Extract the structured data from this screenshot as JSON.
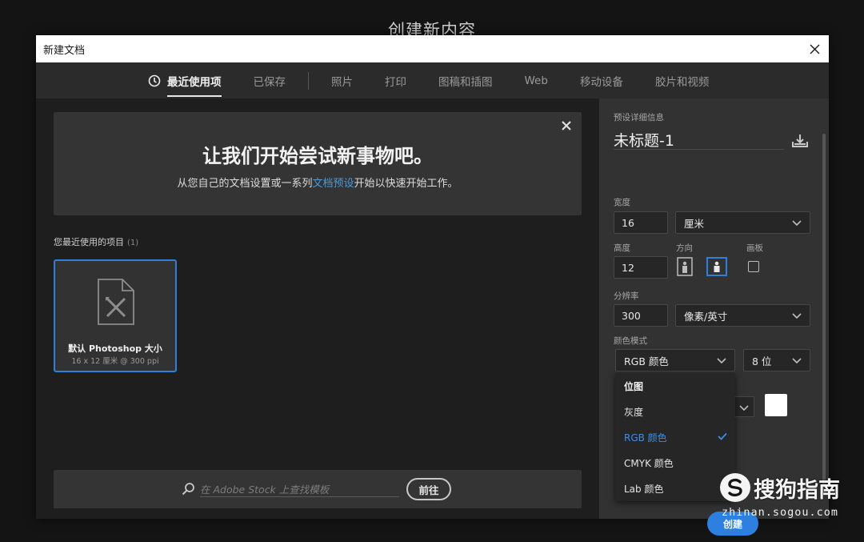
{
  "background_title": "创建新内容",
  "dialog": {
    "title": "新建文档"
  },
  "tabs": [
    {
      "label": "最近使用项",
      "active": true
    },
    {
      "label": "已保存",
      "active": false
    },
    {
      "label": "照片",
      "active": false
    },
    {
      "label": "打印",
      "active": false
    },
    {
      "label": "图稿和插图",
      "active": false
    },
    {
      "label": "Web",
      "active": false
    },
    {
      "label": "移动设备",
      "active": false
    },
    {
      "label": "胶片和视频",
      "active": false
    }
  ],
  "hero": {
    "heading": "让我们开始尝试新事物吧。",
    "text_before": "从您自己的文档设置或一系列",
    "link": "文档预设",
    "text_after": "开始以快速开始工作。"
  },
  "recent": {
    "label": "您最近使用的项目",
    "count": "(1)",
    "items": [
      {
        "name": "默认 Photoshop 大小",
        "info": "16 x 12 厘米 @ 300 ppi"
      }
    ]
  },
  "search": {
    "placeholder": "在 Adobe Stock 上查找模板",
    "go_label": "前往"
  },
  "panel": {
    "section_label": "预设详细信息",
    "doc_name": "未标题-1",
    "width_label": "宽度",
    "width_value": "16",
    "width_unit": "厘米",
    "height_label": "高度",
    "height_value": "12",
    "orientation_label": "方向",
    "artboard_label": "画板",
    "resolution_label": "分辨率",
    "resolution_value": "300",
    "resolution_unit": "像素/英寸",
    "color_mode_label": "颜色模式",
    "color_mode_value": "RGB 颜色",
    "bit_depth": "8 位",
    "color_mode_options": [
      "位图",
      "灰度",
      "RGB 颜色",
      "CMYK 颜色",
      "Lab 颜色"
    ],
    "color_mode_selected": "RGB 颜色",
    "create_label": "创建"
  },
  "watermark": {
    "brand": "搜狗指南",
    "url": "zhinan.sogou.com"
  },
  "colors": {
    "accent": "#2d7fe0",
    "link": "#4a9bdc",
    "dialog_bg": "#232323",
    "panel_bg": "#323232"
  }
}
